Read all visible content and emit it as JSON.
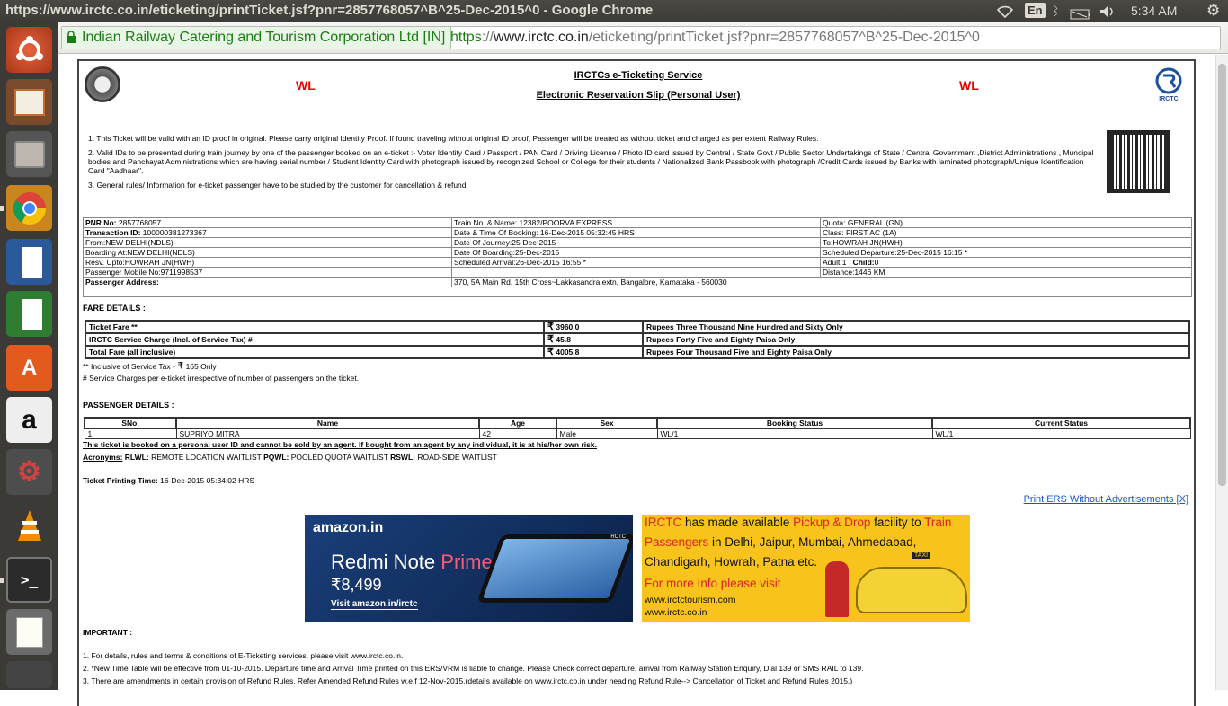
{
  "window": {
    "title": "https://www.irctc.co.in/eticketing/printTicket.jsf?pnr=2857768057^B^25-Dec-2015^0 - Google Chrome",
    "lang_indicator": "En",
    "clock": "5:34 AM"
  },
  "launcher": {
    "items": [
      "ubuntu-dash",
      "impress",
      "file-manager",
      "chrome",
      "writer",
      "calc",
      "software-center",
      "amazon",
      "system-settings",
      "vlc",
      "terminal",
      "text-editor"
    ]
  },
  "address_bar": {
    "ev_label": "Indian Railway Catering and Tourism Corporation Ltd [IN]",
    "url_scheme": "https",
    "url_sep": "://",
    "url_domain": "www.irctc.co.in",
    "url_path": "/eticketing/printTicket.jsf?pnr=2857768057^B^25-Dec-2015^0"
  },
  "ticket": {
    "wl_left": "WL",
    "wl_right": "WL",
    "service_title": "IRCTCs e-Ticketing Service",
    "slip_title": "Electronic Reservation Slip (Personal User)",
    "irctc_logo_text": "IRCTC",
    "rules": [
      "1. This Ticket will be valid with an ID proof in original. Please carry original Identity Proof. If found traveling without original ID proof, Passenger will be treated as without ticket and charged as per extent Railway Rules.",
      "2. Valid IDs to be presented during train journey by one of the passenger booked on an e-ticket :- Voter Identity Card / Passport / PAN Card / Driving License / Photo ID card issued by Central / State Govt / Public Sector Undertakings of State / Central Government ,District Administrations , Muncipal bodies and Panchayat Administrations which are having serial number / Student Identity Card with photograph issued by recognized School or College for their students / Nationalized Bank Passbook with photograph /Credit Cards issued by Banks with laminated photograph/Unique Identification Card \"Aadhaar\".",
      "3. General rules/ Information for e-ticket passenger have to be studied by the customer for cancellation & refund."
    ],
    "pnr": {
      "pnr_label": "PNR No:",
      "pnr_value": "2857768057",
      "txn_label": "Transaction ID:",
      "txn_value": "100000381273367",
      "from": "From:NEW DELHI(NDLS)",
      "boarding": "Boarding At:NEW DELHI(NDLS)",
      "resv_upto": "Resv. Upto:HOWRAH JN(HWH)",
      "mobile": "Passenger Mobile No:9711998537",
      "address_label": "Passenger Address:",
      "train": "Train No. & Name: 12382/POORVA EXPRESS",
      "booking_time": "Date & Time Of Booking:  16-Dec-2015 05:32:45 HRS",
      "journey_date": "Date Of Journey:25-Dec-2015",
      "boarding_date": "Date Of Boarding:25-Dec-2015",
      "sched_arrival": "Scheduled Arrival:26-Dec-2015 16:55 *",
      "address_value": "370, 5A Main Rd, 15th Cross~Lakkasandra extn, Bangalore, Karnataka - 560030",
      "quota": "Quota: GENERAL (GN)",
      "class": "Class: FIRST AC (1A)",
      "to": "To:HOWRAH JN(HWH)",
      "sched_departure": "Scheduled Departure:25-Dec-2015 16:15 *",
      "adult": "Adult:1",
      "child_label": "Child:",
      "child_value": "0",
      "distance": "Distance:1446 KM"
    },
    "fare_heading": "FARE DETAILS :",
    "fares": [
      {
        "label": "Ticket Fare **",
        "amount": "3960.0",
        "words": "Rupees Three Thousand Nine Hundred and Sixty Only"
      },
      {
        "label": "IRCTC Service Charge (Incl. of Service Tax) #",
        "amount": "45.8",
        "words": "Rupees Forty Five and Eighty Paisa Only"
      },
      {
        "label": "Total Fare (all inclusive)",
        "amount": "4005.8",
        "words": "Rupees Four Thousand Five and Eighty Paisa Only"
      }
    ],
    "rupee": "₹",
    "service_tax_prefix": "** Inclusive of Service Tax - ",
    "service_tax_suffix": " 165 Only",
    "service_charge_note": "# Service Charges per e-ticket irrespective of number of passengers on the ticket.",
    "passenger_heading": "PASSENGER DETAILS :",
    "pax_headers": [
      "SNo.",
      "Name",
      "Age",
      "Sex",
      "Booking Status",
      "Current Status"
    ],
    "passengers": [
      {
        "sno": "1",
        "name": "SUPRIYO MITRA",
        "age": "42",
        "sex": "Male",
        "booking_status": "WL/1",
        "current_status": "WL/1"
      }
    ],
    "agent_note": "This ticket is booked on a personal user ID and cannot be sold by an agent. If bought from an agent by any individual, it is at his/her own risk.",
    "acronyms_label": "Acronyms:",
    "acronyms": [
      {
        "code": "RLWL:",
        "meaning": " REMOTE LOCATION WAITLIST "
      },
      {
        "code": "PQWL:",
        "meaning": " POOLED QUOTA WAITLIST "
      },
      {
        "code": "RSWL:",
        "meaning": " ROAD-SIDE WAITLIST"
      }
    ],
    "print_time_label": "Ticket Printing Time:",
    "print_time_value": " 16-Dec-2015 05:34:02 HRS",
    "print_link": "Print ERS Without Advertisements [X]",
    "ad1": {
      "brand": "amazon.in",
      "product_1": "Redmi Note ",
      "product_2": "Prime",
      "price": "₹8,499",
      "cta": "Visit amazon.in/irctc",
      "tag": "IRCTC"
    },
    "ad2": {
      "line1_a": "IRCTC",
      "line1_b": " has made available ",
      "line1_c": "Pickup & Drop",
      "line1_d": " facility to ",
      "line1_e": "Train",
      "line2_a": "Passengers",
      "line2_b": " in Delhi, Jaipur, Mumbai, Ahmedabad,",
      "line3": "Chandigarh, Howrah, Patna etc.",
      "line4": "For more Info please visit",
      "url1": "www.irctctourism.com",
      "url2": "www.irctc.co.in",
      "taxi_sign": "TAXI"
    },
    "important_heading": "IMPORTANT :",
    "important": [
      "1. For details, rules and terms & conditions of E-Ticketing services, please visit www.irctc.co.in.",
      "2. *New Time Table will be effective from 01-10-2015. Departure time and Arrival Time printed on this ERS/VRM is liable to change. Please Check correct departure, arrival from Railway Station Enquiry, Dial 139 or SMS RAIL to 139.",
      "3. There are amendments in certain provision of Refund Rules. Refer Amended Refund Rules w.e.f 12-Nov-2015.(details available on www.irctc.co.in under heading Refund Rule--> Cancellation of Ticket and Refund Rules 2015.)"
    ]
  }
}
